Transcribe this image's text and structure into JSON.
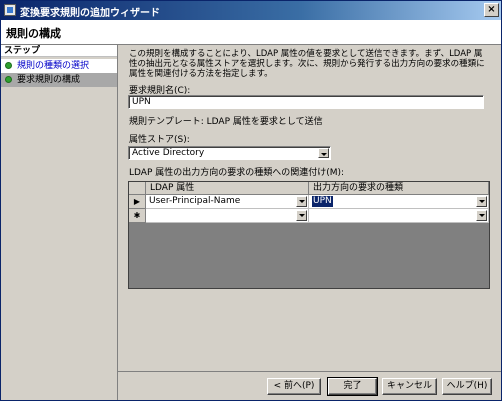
{
  "window": {
    "title": "変換要求規則の追加ウィザード",
    "close": "×"
  },
  "header": {
    "title": "規則の構成"
  },
  "steps": {
    "heading": "ステップ",
    "items": [
      {
        "label": "規則の種類の選択"
      },
      {
        "label": "要求規則の構成"
      }
    ]
  },
  "content": {
    "description": "この規則を構成することにより、LDAP 属性の値を要求として送信できます。まず、LDAP 属性の抽出元となる属性ストアを選択します。次に、規則から発行する出力方向の要求の種類に属性を関連付ける方法を指定します。",
    "claim_rule_name_label": "要求規則名(C):",
    "claim_rule_name_value": "UPN",
    "template_text": "規則テンプレート: LDAP 属性を要求として送信",
    "attribute_store_label": "属性ストア(S):",
    "attribute_store_value": "Active Directory",
    "mapping_label": "LDAP 属性の出力方向の要求の種類への関連付け(M):",
    "grid": {
      "columns": [
        "LDAP 属性",
        "出力方向の要求の種類"
      ],
      "rows": [
        {
          "marker": "▶",
          "ldap": "User-Principal-Name",
          "claim": "UPN"
        },
        {
          "marker": "✱",
          "ldap": "",
          "claim": ""
        }
      ]
    }
  },
  "footer": {
    "back": "< 前へ(P)",
    "finish": "完了",
    "cancel": "キャンセル",
    "help": "ヘルプ(H)"
  }
}
